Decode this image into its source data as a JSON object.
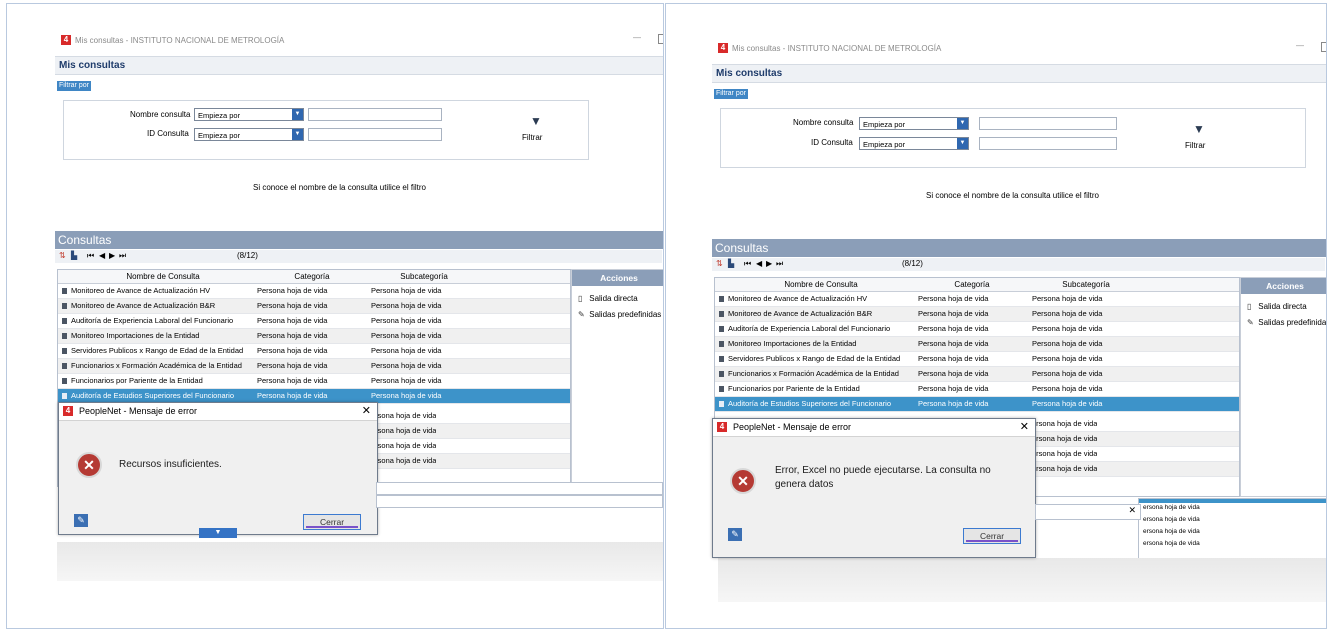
{
  "window": {
    "title": "Mis consultas - INSTITUTO NACIONAL DE METROLOGÍA",
    "logo": "4",
    "minimize": "—"
  },
  "header": {
    "title": "Mis consultas"
  },
  "filter": {
    "tag": "Filtrar por",
    "name_label": "Nombre consulta",
    "id_label": "ID Consulta",
    "mode_value": "Empieza por",
    "button_label": "Filtrar",
    "hint": "Si conoce el nombre de la consulta utilice el filtro"
  },
  "consultas": {
    "title": "Consultas",
    "count": "(8/12)",
    "columns": [
      "Nombre de Consulta",
      "Categoría",
      "Subcategoría"
    ],
    "rows": [
      [
        "Monitoreo de Avance de Actualización HV",
        "Persona hoja de vida",
        "Persona hoja de vida"
      ],
      [
        "Monitoreo de Avance de Actualización B&R",
        "Persona hoja de vida",
        "Persona hoja de vida"
      ],
      [
        "Auditoría de Experiencia Laboral del Funcionario",
        "Persona hoja de vida",
        "Persona hoja de vida"
      ],
      [
        "Monitoreo Importaciones de la Entidad",
        "Persona hoja de vida",
        "Persona hoja de vida"
      ],
      [
        "Servidores Publicos x Rango de Edad de la Entidad",
        "Persona hoja de vida",
        "Persona hoja de vida"
      ],
      [
        "Funcionarios x Formación Académica de la Entidad",
        "Persona hoja de vida",
        "Persona hoja de vida"
      ],
      [
        "Funcionarios por Pariente de la Entidad",
        "Persona hoja de vida",
        "Persona hoja de vida"
      ],
      [
        "Auditoría de Estudios Superiores del Funcionario",
        "Persona hoja de vida",
        "Persona hoja de vida"
      ]
    ],
    "partial_subcat": [
      "ersona hoja de vida",
      "ersona hoja de vida",
      "ersona hoja de vida",
      "ersona hoja de vida"
    ]
  },
  "acciones": {
    "title": "Acciones",
    "items": [
      "Salida directa",
      "Salidas predefinidas"
    ]
  },
  "dialogs": {
    "title": "PeopleNet - Mensaje de error",
    "left_message": "Recursos insuficientes.",
    "right_message_line1": "Error, Excel no puede ejecutarse. La consulta no",
    "right_message_line2": "genera datos",
    "close_label": "Cerrar",
    "close_x": "✕"
  },
  "fragments": {
    "small_subcat": [
      "ersona hoja de vida",
      "ersona hoja de vida",
      "ersona hoja de vida",
      "ersona hoja de vida"
    ]
  }
}
